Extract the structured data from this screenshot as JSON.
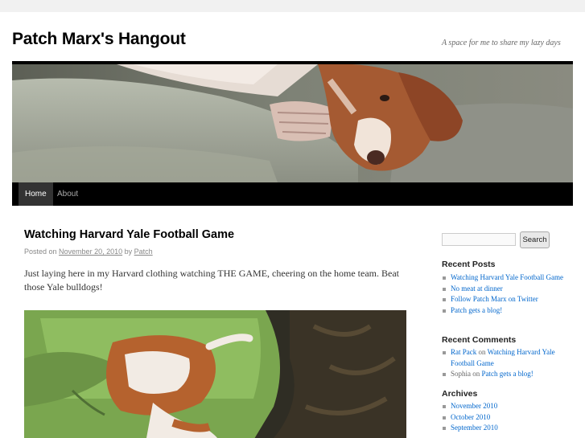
{
  "site": {
    "title": "Patch Marx's Hangout",
    "description": "A space for me to share my lazy days"
  },
  "nav": {
    "items": [
      {
        "label": "Home",
        "current": true
      },
      {
        "label": "About",
        "current": false
      }
    ]
  },
  "post": {
    "title": "Watching Harvard Yale Football Game",
    "posted_on": "Posted on",
    "date": "November 20, 2010",
    "by": "by",
    "author": "Patch",
    "body": "Just laying here in my Harvard clothing watching THE GAME, cheering on the home team. Beat those Yale bulldogs!"
  },
  "sidebar": {
    "search": {
      "placeholder": "",
      "button_label": "Search"
    },
    "recent_posts": {
      "title": "Recent Posts",
      "items": [
        "Watching Harvard Yale Football Game",
        "No meat at dinner",
        "Follow Patch Marx on Twitter",
        "Patch gets a blog!"
      ]
    },
    "recent_comments": {
      "title": "Recent Comments",
      "items": [
        {
          "author": "Rat Pack",
          "on": "on",
          "post": "Watching Harvard Yale Football Game"
        },
        {
          "author": "Sophia",
          "on": "on",
          "post": "Patch gets a blog!"
        }
      ]
    },
    "archives": {
      "title": "Archives",
      "items": [
        "November 2010",
        "October 2010",
        "September 2010"
      ]
    }
  },
  "colors": {
    "link": "#0066cc",
    "nav_bg": "#000000",
    "page_bg": "#f1f1f1"
  }
}
